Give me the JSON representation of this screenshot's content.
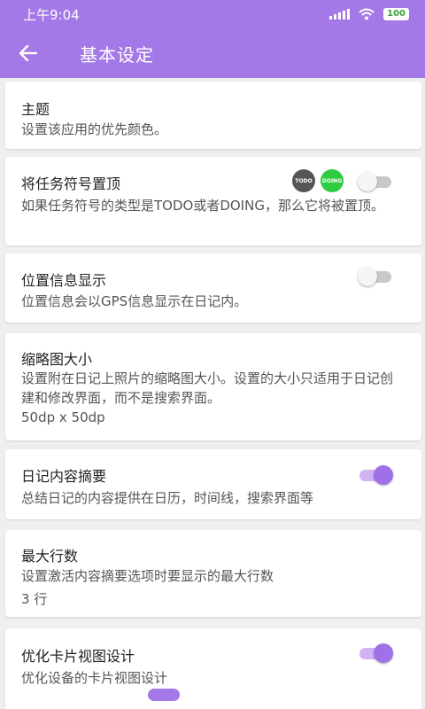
{
  "status": {
    "time": "上午9:04",
    "battery": "100"
  },
  "appbar": {
    "title": "基本设定",
    "back_icon": "arrow-left-icon"
  },
  "settings": [
    {
      "title": "主题",
      "desc": "设置该应用的优先颜色。"
    },
    {
      "title": "将任务符号置顶",
      "desc": "如果任务符号的类型是TODO或者DOING，那么它将被置顶。",
      "chips": [
        "TODO",
        "DOING"
      ],
      "toggle": "off"
    },
    {
      "title": "位置信息显示",
      "desc": "位置信息会以GPS信息显示在日记内。",
      "toggle": "off"
    },
    {
      "title": "缩略图大小",
      "desc": "设置附在日记上照片的缩略图大小。设置的大小只适用于日记创建和修改界面，而不是搜索界面。",
      "value": "50dp x 50dp"
    },
    {
      "title": "日记内容摘要",
      "desc": "总结日记的内容提供在日历，时间线，搜索界面等",
      "toggle": "on"
    },
    {
      "title": "最大行数",
      "desc": "设置激活内容摘要选项时要显示的最大行数",
      "value": "3 行"
    },
    {
      "title": "优化卡片视图设计",
      "desc": "优化设备的卡片视图设计",
      "toggle": "on"
    }
  ],
  "colors": {
    "accent": "#a478e6",
    "todo_chip": "#555555",
    "doing_chip": "#2ecc40"
  },
  "pager": {
    "count": 6,
    "active_index": 0
  }
}
